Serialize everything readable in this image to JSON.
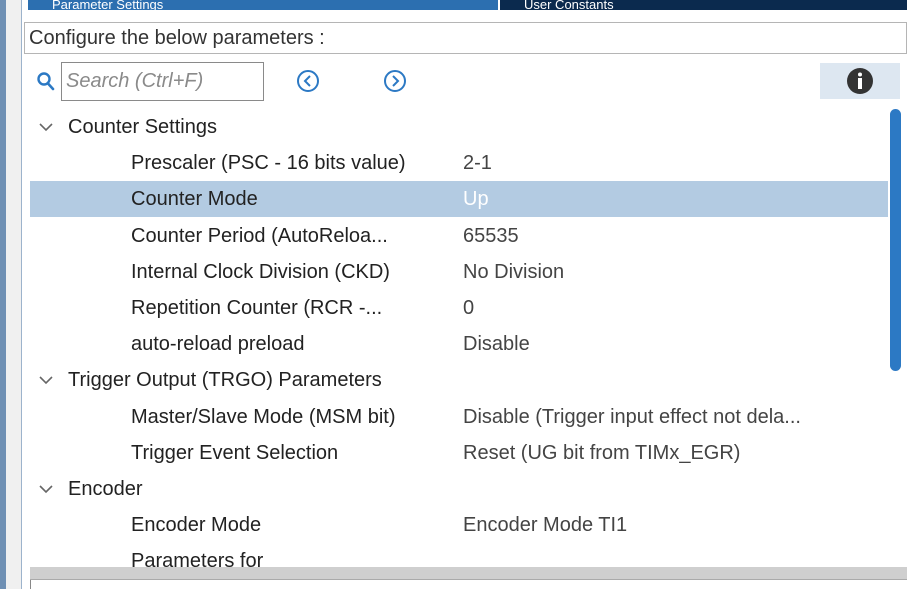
{
  "tabs": [
    {
      "label": "Parameter Settings"
    },
    {
      "label": "User Constants"
    }
  ],
  "config_label": "Configure the below parameters :",
  "search": {
    "placeholder": "Search (Ctrl+F)",
    "value": ""
  },
  "icons": {
    "search": "search-icon",
    "prev": "circle-chevron-left-icon",
    "next": "circle-chevron-right-icon",
    "info": "info-icon",
    "expand": "chevron-down-icon"
  },
  "colors": {
    "accent": "#2c79c4",
    "selected_row": "#b3cbe2",
    "tab_active": "#2c6fb0",
    "tab_inactive": "#0b2a4e"
  },
  "tree": {
    "groups": [
      {
        "label": "Counter Settings",
        "expanded": true,
        "params": [
          {
            "label": "Prescaler (PSC - 16 bits value)",
            "value": "2-1",
            "selected": false
          },
          {
            "label": "Counter Mode",
            "value": "Up",
            "selected": true
          },
          {
            "label": "Counter Period (AutoReloa...",
            "value": "65535",
            "selected": false
          },
          {
            "label": "Internal Clock Division (CKD)",
            "value": "No Division",
            "selected": false
          },
          {
            "label": "Repetition Counter (RCR -...",
            "value": "0",
            "selected": false
          },
          {
            "label": "auto-reload preload",
            "value": "Disable",
            "selected": false
          }
        ]
      },
      {
        "label": "Trigger Output (TRGO) Parameters",
        "expanded": true,
        "params": [
          {
            "label": "Master/Slave Mode (MSM bit)",
            "value": "Disable (Trigger input effect not dela...",
            "selected": false
          },
          {
            "label": "Trigger Event Selection",
            "value": "Reset (UG bit from TIMx_EGR)",
            "selected": false
          }
        ]
      },
      {
        "label": "Encoder",
        "expanded": true,
        "params": [
          {
            "label": "Encoder Mode",
            "value": "Encoder Mode TI1",
            "selected": false
          },
          {
            "label": "Parameters for",
            "value": "",
            "selected": false
          }
        ]
      }
    ]
  }
}
